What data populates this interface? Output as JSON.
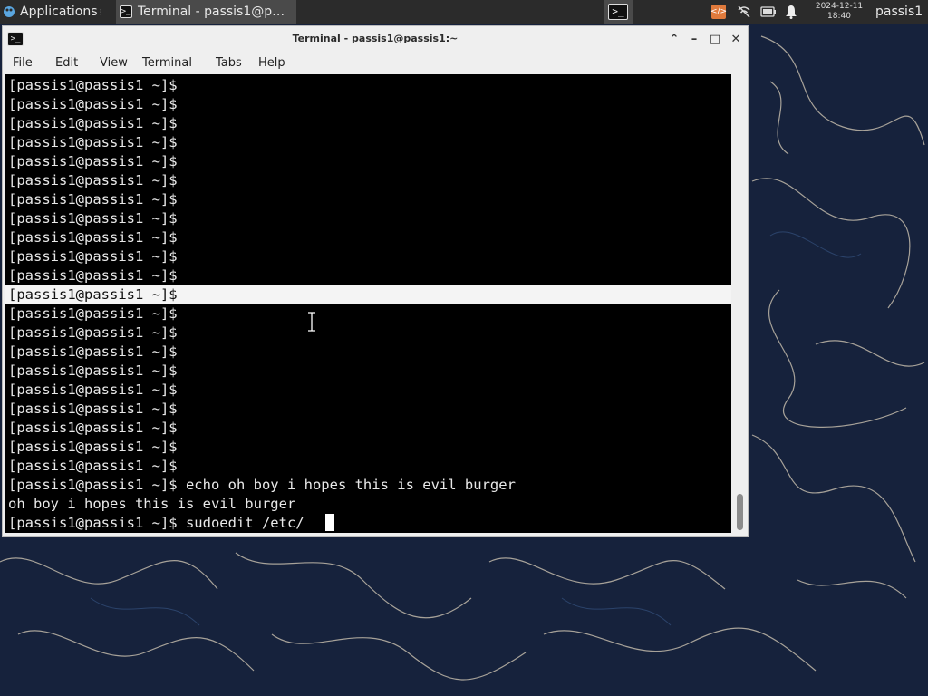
{
  "panel": {
    "applications_label": "Applications",
    "separator": "⁝",
    "task_title": "Terminal - passis1@p…",
    "clock_date": "2024-12-11",
    "clock_time": "18:40",
    "user": "passis1",
    "tray_app_glyph": "</>"
  },
  "window": {
    "title": "Terminal - passis1@passis1:~",
    "buttons": {
      "shade": "⌃",
      "minimize": "–",
      "maximize": "□",
      "close": "✕"
    }
  },
  "menu": [
    "File",
    "Edit",
    "View",
    "Terminal",
    "Tabs",
    "Help"
  ],
  "terminal": {
    "prompt": "[passis1@passis1 ~]$",
    "lines": [
      "[passis1@passis1 ~]$",
      "[passis1@passis1 ~]$",
      "[passis1@passis1 ~]$",
      "[passis1@passis1 ~]$",
      "[passis1@passis1 ~]$",
      "[passis1@passis1 ~]$",
      "[passis1@passis1 ~]$",
      "[passis1@passis1 ~]$",
      "[passis1@passis1 ~]$",
      "[passis1@passis1 ~]$",
      "[passis1@passis1 ~]$",
      "[passis1@passis1 ~]$",
      "[passis1@passis1 ~]$",
      "[passis1@passis1 ~]$",
      "[passis1@passis1 ~]$",
      "[passis1@passis1 ~]$",
      "[passis1@passis1 ~]$",
      "[passis1@passis1 ~]$",
      "[passis1@passis1 ~]$",
      "[passis1@passis1 ~]$",
      "[passis1@passis1 ~]$",
      "[passis1@passis1 ~]$ echo oh boy i hopes this is evil burger",
      "oh boy i hopes this is evil burger",
      "[passis1@passis1 ~]$ sudoedit /etc/"
    ],
    "selected_line_index": 11
  },
  "colors": {
    "panel_bg": "#2b2b2b",
    "window_bg": "#efefef",
    "terminal_bg": "#000000",
    "terminal_fg": "#e8e8e8",
    "selection_bg": "#f4f4f4",
    "wallpaper_bg": "#15213a"
  },
  "icons": {
    "apps": "xfce-mouse-icon",
    "terminal": "terminal-icon",
    "network": "network-disconnected-icon",
    "battery": "battery-icon",
    "notifications": "bell-icon"
  }
}
